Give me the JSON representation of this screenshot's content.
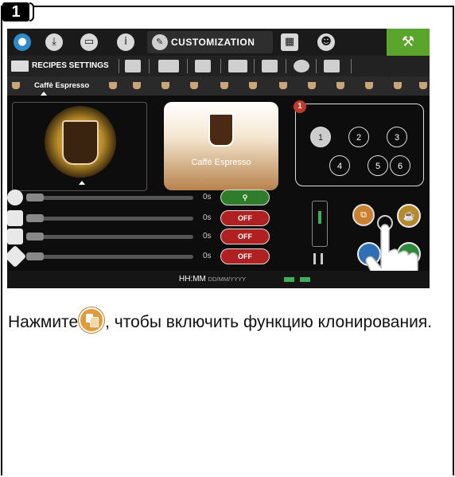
{
  "step": {
    "number": "1"
  },
  "screen": {
    "topbar": {
      "customization_label": "CUSTOMIZATION",
      "wrench_icon": "wrench-icon"
    },
    "subbar": {
      "recipes_settings_label": "RECIPES SETTINGS"
    },
    "recipebar": {
      "selected_recipe": "Caffè Espresso"
    },
    "card": {
      "label": "Caffè Espresso"
    },
    "numbers": {
      "badge": "1",
      "items": [
        "1",
        "2",
        "3",
        "4",
        "5",
        "6"
      ],
      "selected": "1"
    },
    "params": [
      {
        "value": "0s",
        "button": "",
        "button_icon": "pin-icon",
        "state": "green"
      },
      {
        "value": "0s",
        "button": "OFF",
        "state": "red"
      },
      {
        "value": "0s",
        "button": "OFF",
        "state": "red"
      },
      {
        "value": "0s",
        "button": "OFF",
        "state": "red"
      }
    ],
    "bottom": {
      "time": "HH:MM",
      "date": "DD/MM/YYYY"
    },
    "colors": {
      "accent_green": "#5aa52c",
      "off_red": "#b12020",
      "clone_orange": "#c9802f"
    }
  },
  "instruction": {
    "prefix": "Нажмите",
    "suffix": ", чтобы включить функцию клонирования.",
    "icon": "clone-icon"
  }
}
